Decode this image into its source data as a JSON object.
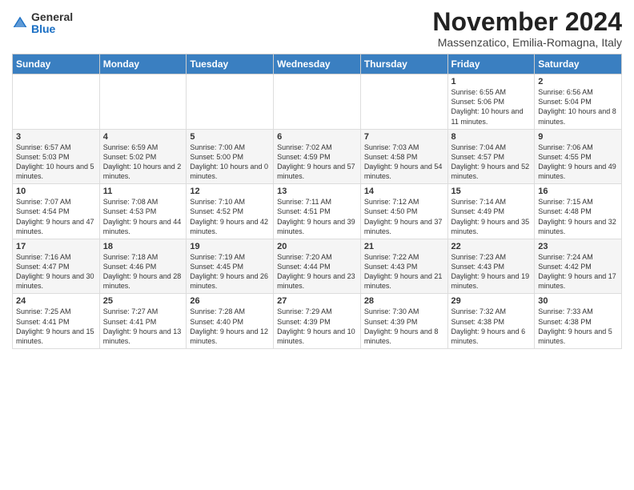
{
  "header": {
    "logo": {
      "general": "General",
      "blue": "Blue"
    },
    "title": "November 2024",
    "subtitle": "Massenzatico, Emilia-Romagna, Italy"
  },
  "days_header": [
    "Sunday",
    "Monday",
    "Tuesday",
    "Wednesday",
    "Thursday",
    "Friday",
    "Saturday"
  ],
  "weeks": [
    [
      {
        "day": "",
        "info": ""
      },
      {
        "day": "",
        "info": ""
      },
      {
        "day": "",
        "info": ""
      },
      {
        "day": "",
        "info": ""
      },
      {
        "day": "",
        "info": ""
      },
      {
        "day": "1",
        "info": "Sunrise: 6:55 AM\nSunset: 5:06 PM\nDaylight: 10 hours and 11 minutes."
      },
      {
        "day": "2",
        "info": "Sunrise: 6:56 AM\nSunset: 5:04 PM\nDaylight: 10 hours and 8 minutes."
      }
    ],
    [
      {
        "day": "3",
        "info": "Sunrise: 6:57 AM\nSunset: 5:03 PM\nDaylight: 10 hours and 5 minutes."
      },
      {
        "day": "4",
        "info": "Sunrise: 6:59 AM\nSunset: 5:02 PM\nDaylight: 10 hours and 2 minutes."
      },
      {
        "day": "5",
        "info": "Sunrise: 7:00 AM\nSunset: 5:00 PM\nDaylight: 10 hours and 0 minutes."
      },
      {
        "day": "6",
        "info": "Sunrise: 7:02 AM\nSunset: 4:59 PM\nDaylight: 9 hours and 57 minutes."
      },
      {
        "day": "7",
        "info": "Sunrise: 7:03 AM\nSunset: 4:58 PM\nDaylight: 9 hours and 54 minutes."
      },
      {
        "day": "8",
        "info": "Sunrise: 7:04 AM\nSunset: 4:57 PM\nDaylight: 9 hours and 52 minutes."
      },
      {
        "day": "9",
        "info": "Sunrise: 7:06 AM\nSunset: 4:55 PM\nDaylight: 9 hours and 49 minutes."
      }
    ],
    [
      {
        "day": "10",
        "info": "Sunrise: 7:07 AM\nSunset: 4:54 PM\nDaylight: 9 hours and 47 minutes."
      },
      {
        "day": "11",
        "info": "Sunrise: 7:08 AM\nSunset: 4:53 PM\nDaylight: 9 hours and 44 minutes."
      },
      {
        "day": "12",
        "info": "Sunrise: 7:10 AM\nSunset: 4:52 PM\nDaylight: 9 hours and 42 minutes."
      },
      {
        "day": "13",
        "info": "Sunrise: 7:11 AM\nSunset: 4:51 PM\nDaylight: 9 hours and 39 minutes."
      },
      {
        "day": "14",
        "info": "Sunrise: 7:12 AM\nSunset: 4:50 PM\nDaylight: 9 hours and 37 minutes."
      },
      {
        "day": "15",
        "info": "Sunrise: 7:14 AM\nSunset: 4:49 PM\nDaylight: 9 hours and 35 minutes."
      },
      {
        "day": "16",
        "info": "Sunrise: 7:15 AM\nSunset: 4:48 PM\nDaylight: 9 hours and 32 minutes."
      }
    ],
    [
      {
        "day": "17",
        "info": "Sunrise: 7:16 AM\nSunset: 4:47 PM\nDaylight: 9 hours and 30 minutes."
      },
      {
        "day": "18",
        "info": "Sunrise: 7:18 AM\nSunset: 4:46 PM\nDaylight: 9 hours and 28 minutes."
      },
      {
        "day": "19",
        "info": "Sunrise: 7:19 AM\nSunset: 4:45 PM\nDaylight: 9 hours and 26 minutes."
      },
      {
        "day": "20",
        "info": "Sunrise: 7:20 AM\nSunset: 4:44 PM\nDaylight: 9 hours and 23 minutes."
      },
      {
        "day": "21",
        "info": "Sunrise: 7:22 AM\nSunset: 4:43 PM\nDaylight: 9 hours and 21 minutes."
      },
      {
        "day": "22",
        "info": "Sunrise: 7:23 AM\nSunset: 4:43 PM\nDaylight: 9 hours and 19 minutes."
      },
      {
        "day": "23",
        "info": "Sunrise: 7:24 AM\nSunset: 4:42 PM\nDaylight: 9 hours and 17 minutes."
      }
    ],
    [
      {
        "day": "24",
        "info": "Sunrise: 7:25 AM\nSunset: 4:41 PM\nDaylight: 9 hours and 15 minutes."
      },
      {
        "day": "25",
        "info": "Sunrise: 7:27 AM\nSunset: 4:41 PM\nDaylight: 9 hours and 13 minutes."
      },
      {
        "day": "26",
        "info": "Sunrise: 7:28 AM\nSunset: 4:40 PM\nDaylight: 9 hours and 12 minutes."
      },
      {
        "day": "27",
        "info": "Sunrise: 7:29 AM\nSunset: 4:39 PM\nDaylight: 9 hours and 10 minutes."
      },
      {
        "day": "28",
        "info": "Sunrise: 7:30 AM\nSunset: 4:39 PM\nDaylight: 9 hours and 8 minutes."
      },
      {
        "day": "29",
        "info": "Sunrise: 7:32 AM\nSunset: 4:38 PM\nDaylight: 9 hours and 6 minutes."
      },
      {
        "day": "30",
        "info": "Sunrise: 7:33 AM\nSunset: 4:38 PM\nDaylight: 9 hours and 5 minutes."
      }
    ]
  ]
}
